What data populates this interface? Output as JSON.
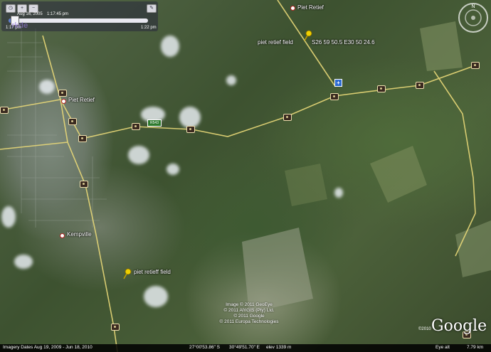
{
  "timebar": {
    "date": "Aug 16, 2005",
    "time": "1:17:45 pm",
    "start_time": "1:17 pm",
    "end_time": "1:22 pm",
    "progress": 0.04,
    "watermark": "rkde"
  },
  "places": [
    {
      "name": "Piet Retief"
    },
    {
      "name": "Piet Retief"
    },
    {
      "name": "Kempville"
    }
  ],
  "placemarks": [
    {
      "name": "piet retief field"
    },
    {
      "name": "S26 59 50.5 E30 50 24.6"
    },
    {
      "name": "piet retieff field"
    }
  ],
  "road_shield": "R543",
  "credits": [
    "Image © 2011 GeoEye",
    "© 2011 AfriGIS (Pty) Ltd.",
    "© 2011 Google",
    "© 2011 Europa Technologies"
  ],
  "brand": "Google",
  "brand_year": "©2010",
  "statusbar": {
    "imagery_dates": "Imagery Dates   Aug 19, 2009 - Jun 18, 2010",
    "lat": "27°00'53.86\" S",
    "lon": "30°49'51.70\" E",
    "elevation": "elev 1339 m",
    "eye_alt_label": "Eye alt",
    "eye_alt_value": "7.79 km"
  },
  "compass_north": "N",
  "colors": {
    "road": "#e8d878",
    "accent_blue": "#5a7ad0"
  }
}
